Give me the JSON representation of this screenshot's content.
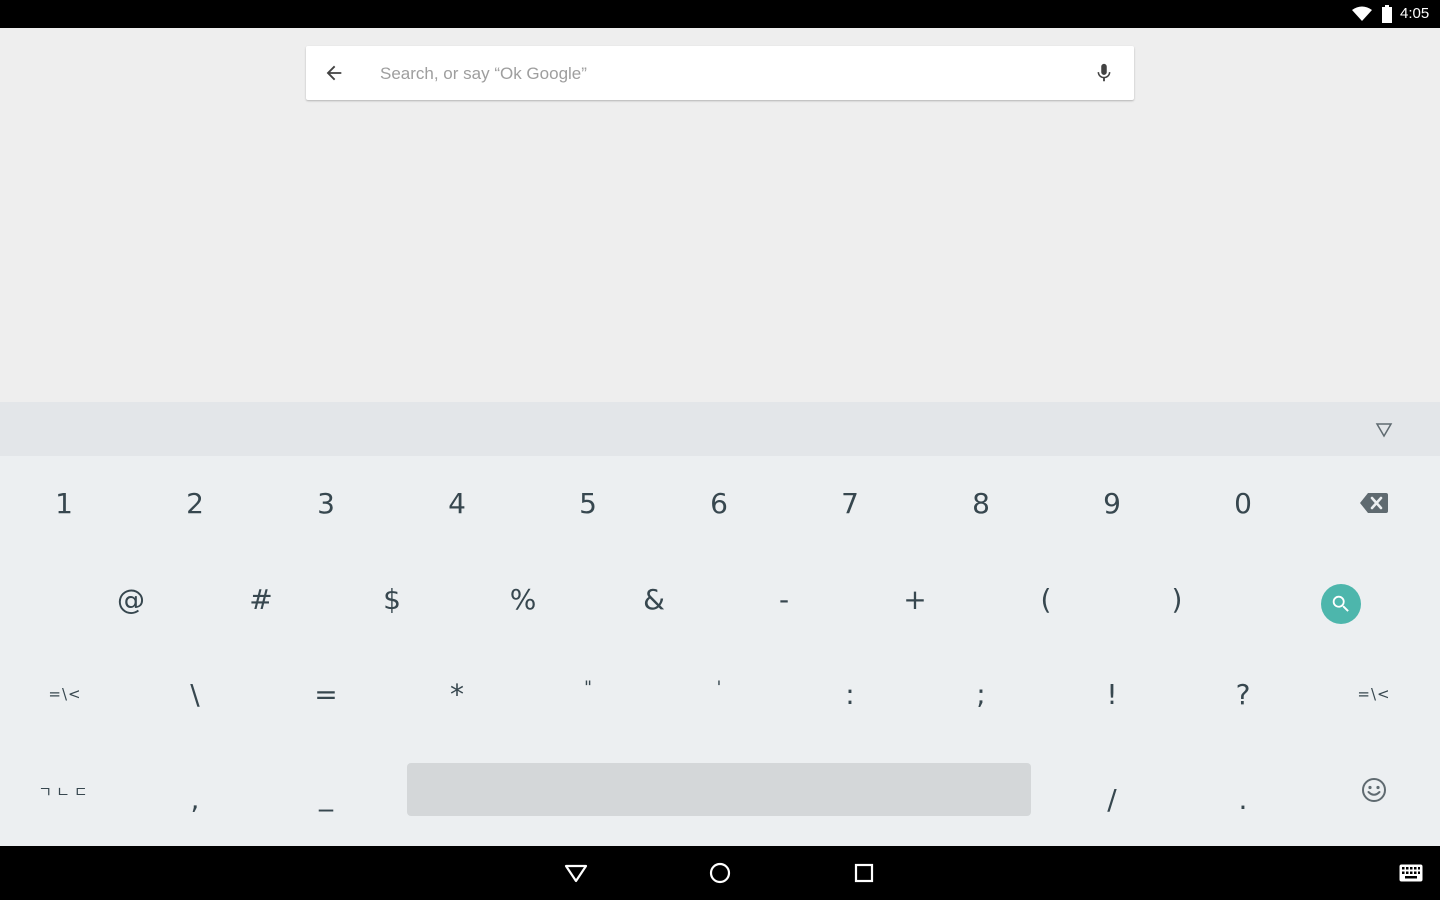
{
  "status_bar": {
    "time": "4:05"
  },
  "search": {
    "placeholder": "Search, or say “Ok Google”"
  },
  "keyboard": {
    "row1": [
      "1",
      "2",
      "3",
      "4",
      "5",
      "6",
      "7",
      "8",
      "9",
      "0"
    ],
    "row2": [
      "@",
      "#",
      "$",
      "%",
      "&",
      "-",
      "+",
      "(",
      ")"
    ],
    "row3": [
      "\\",
      "=",
      "*",
      "\"",
      "'",
      ":",
      ";",
      "!",
      "?"
    ],
    "row3_left_label": "=\\<",
    "row3_right_label": "=\\<",
    "row4_left_label": "ㄱㄴㄷ",
    "row4": [
      ",",
      "_",
      "/",
      "."
    ]
  },
  "colors": {
    "accent": "#4db6ac",
    "key_text": "#37474f",
    "keyboard_bg": "#eceff1",
    "suggestion_bg": "#e3e6e9",
    "space_key": "#d4d7d9",
    "background": "#eeeeee"
  },
  "icons": {
    "back": "arrow-back-icon",
    "mic": "microphone-icon",
    "collapse": "triangle-down-icon",
    "backspace": "backspace-icon",
    "search": "search-icon",
    "emoji": "smiley-icon",
    "nav_back": "nav-back-icon",
    "nav_home": "nav-home-icon",
    "nav_recent": "nav-recent-icon",
    "keyboard": "keyboard-icon"
  }
}
